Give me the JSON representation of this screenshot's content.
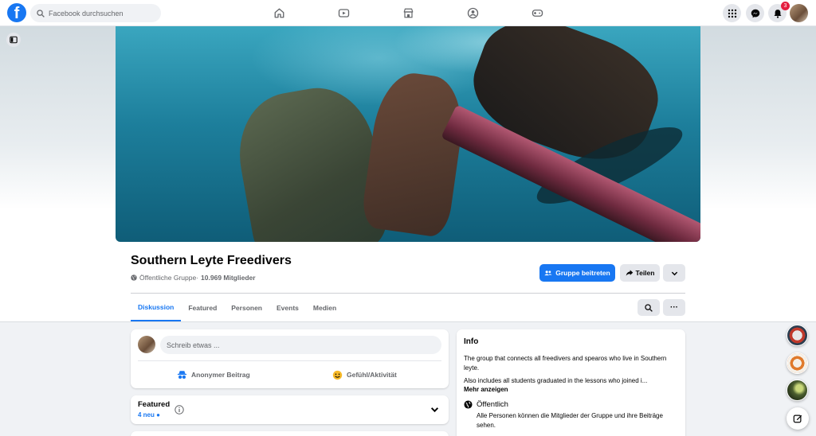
{
  "topbar": {
    "logo_letter": "f",
    "search_placeholder": "Facebook durchsuchen",
    "notifications_count": "3"
  },
  "group": {
    "name": "Southern Leyte Freedivers",
    "privacy": "Öffentliche Gruppe",
    "separator": " · ",
    "members": "10.969 Mitglieder",
    "join_label": "Gruppe beitreten",
    "share_label": "Teilen"
  },
  "tabs": [
    {
      "label": "Diskussion",
      "active": true
    },
    {
      "label": "Featured",
      "active": false
    },
    {
      "label": "Personen",
      "active": false
    },
    {
      "label": "Events",
      "active": false
    },
    {
      "label": "Medien",
      "active": false
    }
  ],
  "tab_more_label": "···",
  "composer": {
    "placeholder": "Schreib etwas ...",
    "anonymous_label": "Anonymer Beitrag",
    "feeling_label": "Gefühl/Aktivität"
  },
  "featured": {
    "title": "Featured",
    "new_count": "4 neu ●"
  },
  "info": {
    "title": "Info",
    "description": "The group that connects all freedivers and spearos who live in Southern leyte.",
    "description_more": "Also includes all students graduated in the lessons who joined i...",
    "show_more": "Mehr anzeigen",
    "public_title": "Öffentlich",
    "public_desc": "Alle Personen können die Mitglieder der Gruppe und ihre Beiträge sehen."
  },
  "colors": {
    "brand": "#1877f2",
    "badge": "#e41e3f"
  },
  "icons": [
    "search-icon",
    "home-icon",
    "watch-icon",
    "marketplace-icon",
    "groups-icon",
    "gaming-icon",
    "menu-grid-icon",
    "messenger-icon",
    "bell-icon",
    "globe-icon",
    "share-icon",
    "chevron-down-icon",
    "compose-icon"
  ]
}
